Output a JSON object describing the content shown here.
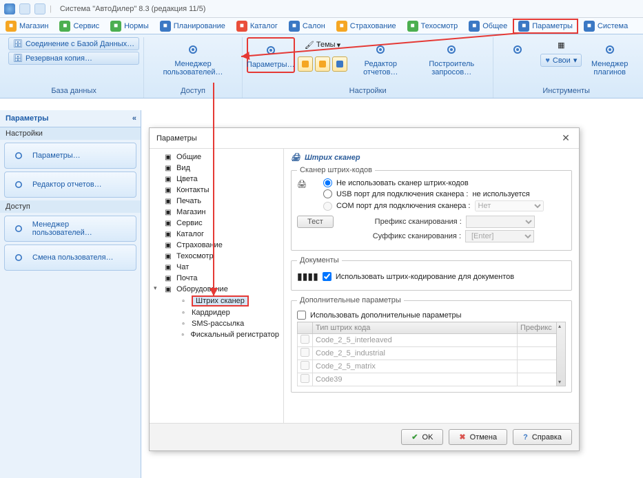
{
  "title": "Система \"АвтоДилер\" 8.3 (редакция 11/5)",
  "tabs": [
    {
      "label": "Магазин",
      "icon_bg": "#f5a623"
    },
    {
      "label": "Сервис",
      "icon_bg": "#4caf50"
    },
    {
      "label": "Нормы",
      "icon_bg": "#4caf50"
    },
    {
      "label": "Планирование",
      "icon_bg": "#3b78c4"
    },
    {
      "label": "Каталог",
      "icon_bg": "#e94e3a"
    },
    {
      "label": "Салон",
      "icon_bg": "#3b78c4"
    },
    {
      "label": "Страхование",
      "icon_bg": "#f5a623"
    },
    {
      "label": "Техосмотр",
      "icon_bg": "#4caf50"
    },
    {
      "label": "Общее",
      "icon_bg": "#3b78c4"
    },
    {
      "label": "Параметры",
      "icon_bg": "#3b78c4",
      "hl": true
    },
    {
      "label": "Система",
      "icon_bg": "#3b78c4"
    }
  ],
  "ribbon": {
    "groups": [
      {
        "label": "База данных",
        "items": [
          {
            "kind": "smallbtn",
            "label": "Соединение с Базой Данных…"
          },
          {
            "kind": "smallbtn",
            "label": "Резервная копия…"
          }
        ]
      },
      {
        "label": "Доступ",
        "items": [
          {
            "kind": "big",
            "label": "Менеджер пользователей…"
          }
        ]
      },
      {
        "label": "Настройки",
        "items": [
          {
            "kind": "big",
            "label": "Параметры…",
            "hl": true
          },
          {
            "kind": "themes",
            "label": "Темы"
          },
          {
            "kind": "squares"
          },
          {
            "kind": "big",
            "label": "Редактор отчетов…"
          },
          {
            "kind": "big",
            "label": "Построитель запросов…"
          }
        ]
      },
      {
        "label": "Инструменты",
        "items": [
          {
            "kind": "big",
            "label": ""
          },
          {
            "kind": "svoi",
            "label": "Свои"
          },
          {
            "kind": "big",
            "label": "Менеджер плагинов"
          }
        ]
      }
    ]
  },
  "leftpane": {
    "title": "Параметры",
    "sections": [
      {
        "label": "Настройки",
        "items": [
          {
            "label": "Параметры…"
          },
          {
            "label": "Редактор отчетов…"
          }
        ]
      },
      {
        "label": "Доступ",
        "items": [
          {
            "label": "Менеджер пользователей…"
          },
          {
            "label": "Смена пользователя…"
          }
        ]
      }
    ]
  },
  "dialog": {
    "title": "Параметры",
    "tree": [
      {
        "label": "Общие"
      },
      {
        "label": "Вид"
      },
      {
        "label": "Цвета"
      },
      {
        "label": "Контакты"
      },
      {
        "label": "Печать"
      },
      {
        "label": "Магазин"
      },
      {
        "label": "Сервис"
      },
      {
        "label": "Каталог"
      },
      {
        "label": "Страхование"
      },
      {
        "label": "Техосмотр"
      },
      {
        "label": "Чат"
      },
      {
        "label": "Почта"
      },
      {
        "label": "Оборудование",
        "expanded": true,
        "children": [
          {
            "label": "Штрих сканер",
            "sel": true
          },
          {
            "label": "Кардридер"
          },
          {
            "label": "SMS-рассылка"
          },
          {
            "label": "Фискальный регистратор"
          }
        ]
      }
    ],
    "content": {
      "heading": "Штрих сканер",
      "scanner_group": "Сканер штрих-кодов",
      "radio": [
        {
          "label": "Не использовать сканер штрих-кодов",
          "checked": true
        },
        {
          "label": "USB порт для подключения сканера :",
          "after": "не используется"
        },
        {
          "label": "COM порт для подключения сканера :",
          "select": "Нет",
          "disabled": true
        }
      ],
      "prefix_label": "Префикс сканирования :",
      "prefix_value": "",
      "suffix_label": "Суффикс сканирования :",
      "suffix_value": "[Enter]",
      "test_btn": "Тест",
      "docs_group": "Документы",
      "docs_check": "Использовать штрих-кодирование для документов",
      "extra_group": "Дополнительные параметры",
      "extra_check": "Использовать дополнительные параметры",
      "table": {
        "cols": [
          "Тип штрих кода",
          "Префикс"
        ],
        "rows": [
          {
            "type": "Code_2_5_interleaved",
            "prefix": ""
          },
          {
            "type": "Code_2_5_industrial",
            "prefix": ""
          },
          {
            "type": "Code_2_5_matrix",
            "prefix": ""
          },
          {
            "type": "Code39",
            "prefix": ""
          }
        ]
      }
    },
    "footer": {
      "ok": "OK",
      "cancel": "Отмена",
      "help": "Справка"
    }
  }
}
